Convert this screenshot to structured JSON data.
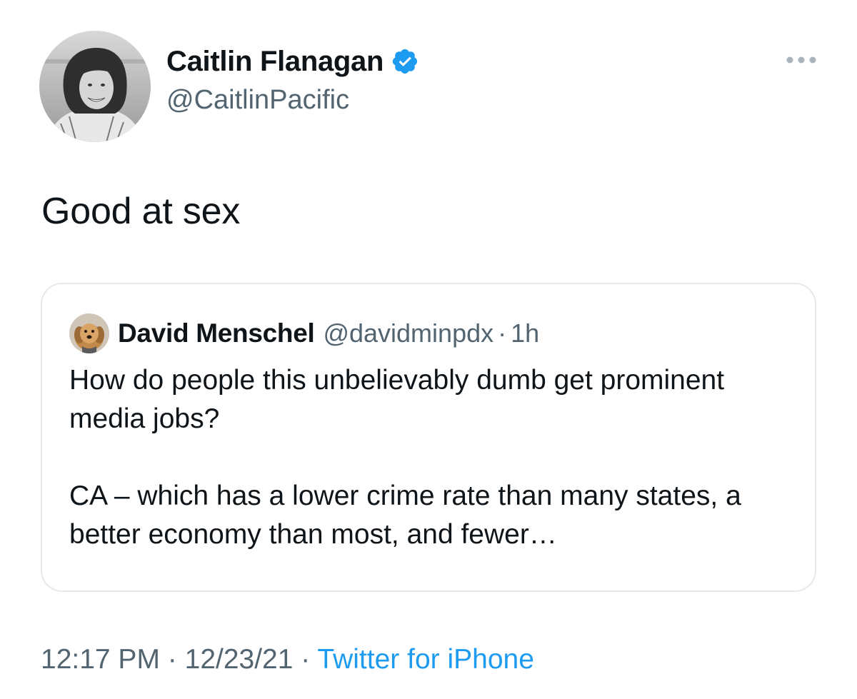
{
  "author": {
    "display_name": "Caitlin Flanagan",
    "handle": "@CaitlinPacific",
    "verified": true,
    "avatar_icon": "profile-photo"
  },
  "tweet": {
    "text": "Good at sex"
  },
  "quoted_tweet": {
    "display_name": "David Menschel",
    "handle": "@davidminpdx",
    "separator": "·",
    "time_ago": "1h",
    "body_paragraph_1": "How do people this unbelievably dumb get prominent media jobs?",
    "body_paragraph_2": "CA – which has a lower crime rate than many states, a better economy than most, and fewer…"
  },
  "meta": {
    "time": "12:17 PM",
    "separator_1": "·",
    "date": "12/23/21",
    "separator_2": "·",
    "source": "Twitter for iPhone"
  },
  "colors": {
    "text_primary": "#0f1419",
    "text_secondary": "#536471",
    "accent_blue": "#1d9bf0",
    "border": "#e6e9ec"
  },
  "icons": {
    "verified": "verified-badge-icon",
    "more": "more-dots-icon"
  }
}
